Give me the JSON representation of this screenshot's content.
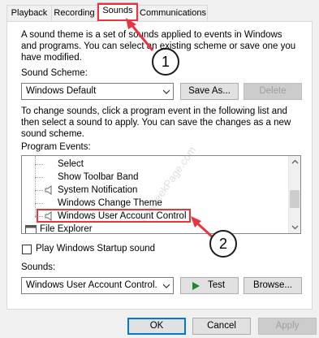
{
  "tabs": [
    {
      "label": "Playback"
    },
    {
      "label": "Recording"
    },
    {
      "label": "Sounds"
    },
    {
      "label": "Communications"
    }
  ],
  "intro_text_lines": [
    "A sound theme is a set of sounds applied to events in Windows",
    "and programs.  You can select an existing scheme or save one you",
    "have modified."
  ],
  "scheme": {
    "label": "Sound Scheme:",
    "selected": "Windows Default",
    "save_as_label": "Save As...",
    "delete_label": "Delete"
  },
  "change_text_lines": [
    "To change sounds, click a program event in the following list and",
    "then select a sound to apply.  You can save the changes as a new",
    "sound scheme."
  ],
  "program_events": {
    "label": "Program Events:",
    "items": [
      {
        "label": "Select",
        "has_sound": false
      },
      {
        "label": "Show Toolbar Band",
        "has_sound": false
      },
      {
        "label": "System Notification",
        "has_sound": true
      },
      {
        "label": "Windows Change Theme",
        "has_sound": false
      },
      {
        "label": "Windows User Account Control",
        "has_sound": true,
        "selected": true
      },
      {
        "label": "File Explorer",
        "is_group": true
      }
    ]
  },
  "startup_sound": {
    "label": "Play Windows Startup sound",
    "checked": false
  },
  "sounds": {
    "label": "Sounds:",
    "selected": "Windows User Account Control.",
    "test_label": "Test",
    "browse_label": "Browse..."
  },
  "footer": {
    "ok_label": "OK",
    "cancel_label": "Cancel",
    "apply_label": "Apply"
  },
  "callouts": [
    "1",
    "2"
  ],
  "watermark": "TheGeekPage.com",
  "colors": {
    "accent_red": "#e8343f",
    "test_green": "#1d8a2e",
    "focus_blue": "#0078d7"
  }
}
